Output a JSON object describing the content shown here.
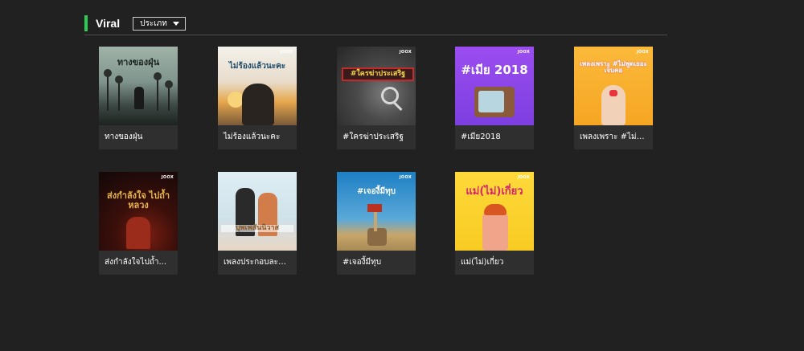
{
  "section": {
    "title": "Viral",
    "category_select": {
      "label": "ประเภท"
    },
    "accent_color": "#2ecc55"
  },
  "playlists": [
    {
      "title": "ทางของฝุ่น",
      "cover_text": "ทางของฝุ่น"
    },
    {
      "title": "ไม่ร้องแล้วนะคะ",
      "cover_text": "ไม่ร้องแล้วนะคะ"
    },
    {
      "title": "#ใครฆ่าประเสริฐ",
      "cover_text": "#ใครฆ่าประเสริฐ"
    },
    {
      "title": "#เมีย2018",
      "cover_text": "#เมีย 2018"
    },
    {
      "title": "เพลงเพราะ #ไม่พู...",
      "cover_text": "เพลงเพราะ #ไม่พูดเยอะเจ็บคอ"
    },
    {
      "title": "ส่งกำลังใจไปถ้ำ...",
      "cover_text": "ส่งกำลังใจ ไปถ้ำหลวง"
    },
    {
      "title": "เพลงประกอบละค...",
      "cover_text": "บุพเพสันนิวาส"
    },
    {
      "title": "#เจองี้มีทุบ",
      "cover_text": "#เจองี้มีทุบ"
    },
    {
      "title": "แม่(ไม่)เกี่ยว",
      "cover_text": "แม่(ไม่)เกี่ยว"
    }
  ],
  "brand": {
    "logo_text": "JOOX"
  }
}
